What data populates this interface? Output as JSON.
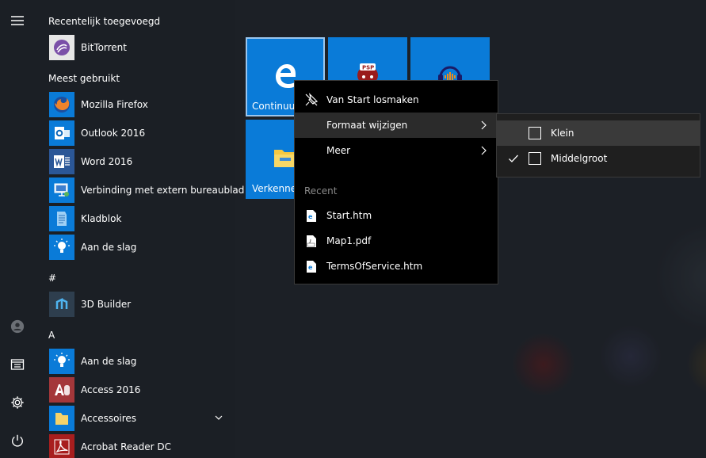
{
  "colors": {
    "tile_blue": "#0a7bd8",
    "menu_bg": "#000000",
    "submenu_bg": "#1f1f1f",
    "highlight": "#2b2b2b"
  },
  "rail": {
    "items": [
      {
        "name": "hamburger-menu-icon"
      },
      {
        "name": "user-icon"
      },
      {
        "name": "documents-icon"
      },
      {
        "name": "settings-icon"
      },
      {
        "name": "power-icon"
      }
    ]
  },
  "applist": {
    "recent_header": "Recentelijk toegevoegd",
    "recent": [
      {
        "label": "BitTorrent",
        "icon": "bittorrent-icon"
      }
    ],
    "most_used_header": "Meest gebruikt",
    "most_used": [
      {
        "label": "Mozilla Firefox",
        "icon": "firefox-icon"
      },
      {
        "label": "Outlook 2016",
        "icon": "outlook-icon"
      },
      {
        "label": "Word 2016",
        "icon": "word-icon"
      },
      {
        "label": "Verbinding met extern bureaublad",
        "icon": "remote-desktop-icon"
      },
      {
        "label": "Kladblok",
        "icon": "notepad-icon"
      },
      {
        "label": "Aan de slag",
        "icon": "lightbulb-icon"
      }
    ],
    "hash_header": "#",
    "hash_items": [
      {
        "label": "3D Builder",
        "icon": "3d-builder-icon"
      }
    ],
    "a_header": "A",
    "a_items": [
      {
        "label": "Aan de slag",
        "icon": "lightbulb-icon"
      },
      {
        "label": "Access 2016",
        "icon": "access-icon"
      },
      {
        "label": "Accessoires",
        "icon": "folder-icon"
      },
      {
        "label": "Acrobat Reader DC",
        "icon": "acrobat-icon"
      }
    ]
  },
  "tiles": [
    {
      "label": "Continuum",
      "icon": "edge-icon"
    },
    {
      "label": "",
      "icon": "psp-icon"
    },
    {
      "label": "",
      "icon": "audacity-icon"
    },
    {
      "label": "Verkenner",
      "icon": "file-explorer-icon"
    }
  ],
  "context_menu": {
    "items": [
      {
        "label": "Van Start losmaken",
        "icon": "unpin-icon"
      },
      {
        "label": "Formaat wijzigen",
        "icon": ""
      },
      {
        "label": "Meer",
        "icon": ""
      }
    ],
    "recent_header": "Recent",
    "recent": [
      {
        "label": "Start.htm",
        "icon": "htm-file-icon"
      },
      {
        "label": "Map1.pdf",
        "icon": "pdf-file-icon"
      },
      {
        "label": "TermsOfService.htm",
        "icon": "htm-file-icon"
      }
    ]
  },
  "submenu": {
    "items": [
      {
        "label": "Klein",
        "checked": false
      },
      {
        "label": "Middelgroot",
        "checked": true
      }
    ]
  }
}
